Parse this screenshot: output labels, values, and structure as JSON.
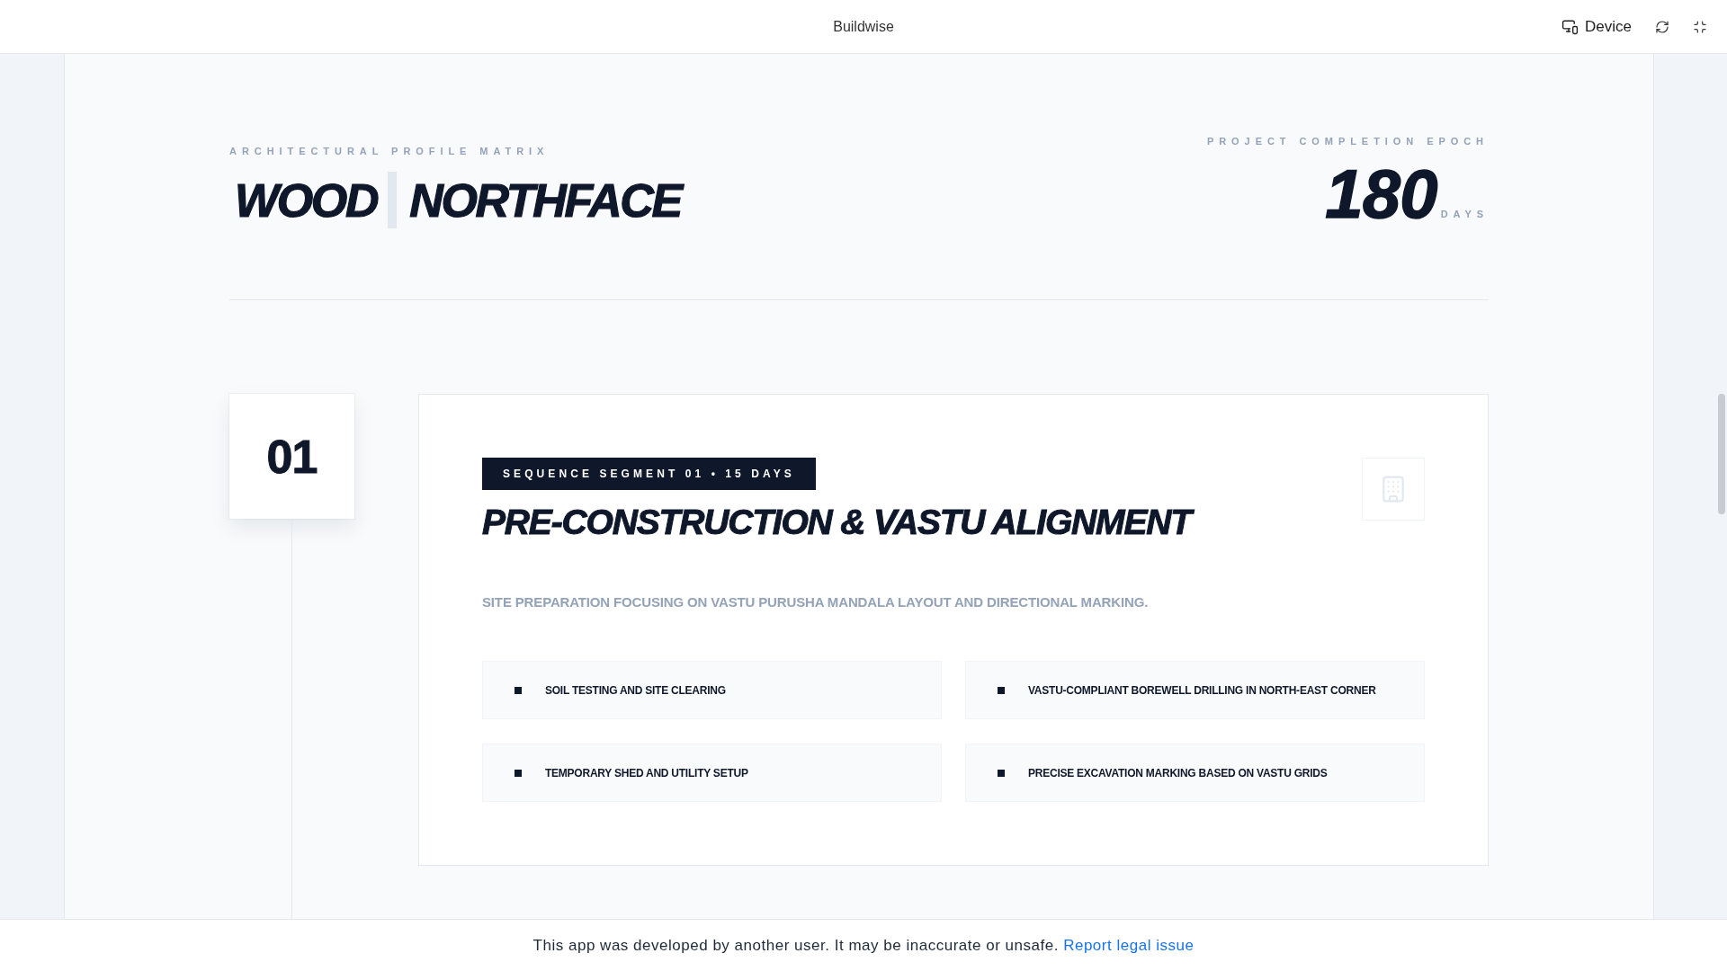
{
  "top_bar": {
    "title": "Buildwise",
    "device_label": "Device"
  },
  "header": {
    "eyebrow": "ARCHITECTURAL PROFILE MATRIX",
    "material": "WOOD",
    "facing": "NORTHFACE",
    "completion_label": "PROJECT COMPLETION EPOCH",
    "completion_value": "180",
    "completion_unit": "DAYS"
  },
  "phases": [
    {
      "number": "01",
      "badge": "SEQUENCE SEGMENT 01 • 15 DAYS",
      "title": "PRE-CONSTRUCTION & VASTU ALIGNMENT",
      "description": "SITE PREPARATION FOCUSING ON VASTU PURUSHA MANDALA LAYOUT AND DIRECTIONAL MARKING.",
      "tasks": [
        "SOIL TESTING AND SITE CLEARING",
        "VASTU-COMPLIANT BOREWELL DRILLING IN NORTH-EAST CORNER",
        "TEMPORARY SHED AND UTILITY SETUP",
        "PRECISE EXCAVATION MARKING BASED ON VASTU GRIDS"
      ]
    }
  ],
  "footer": {
    "notice": "This app was developed by another user. It may be inaccurate or unsafe.",
    "link": "Report legal issue"
  }
}
